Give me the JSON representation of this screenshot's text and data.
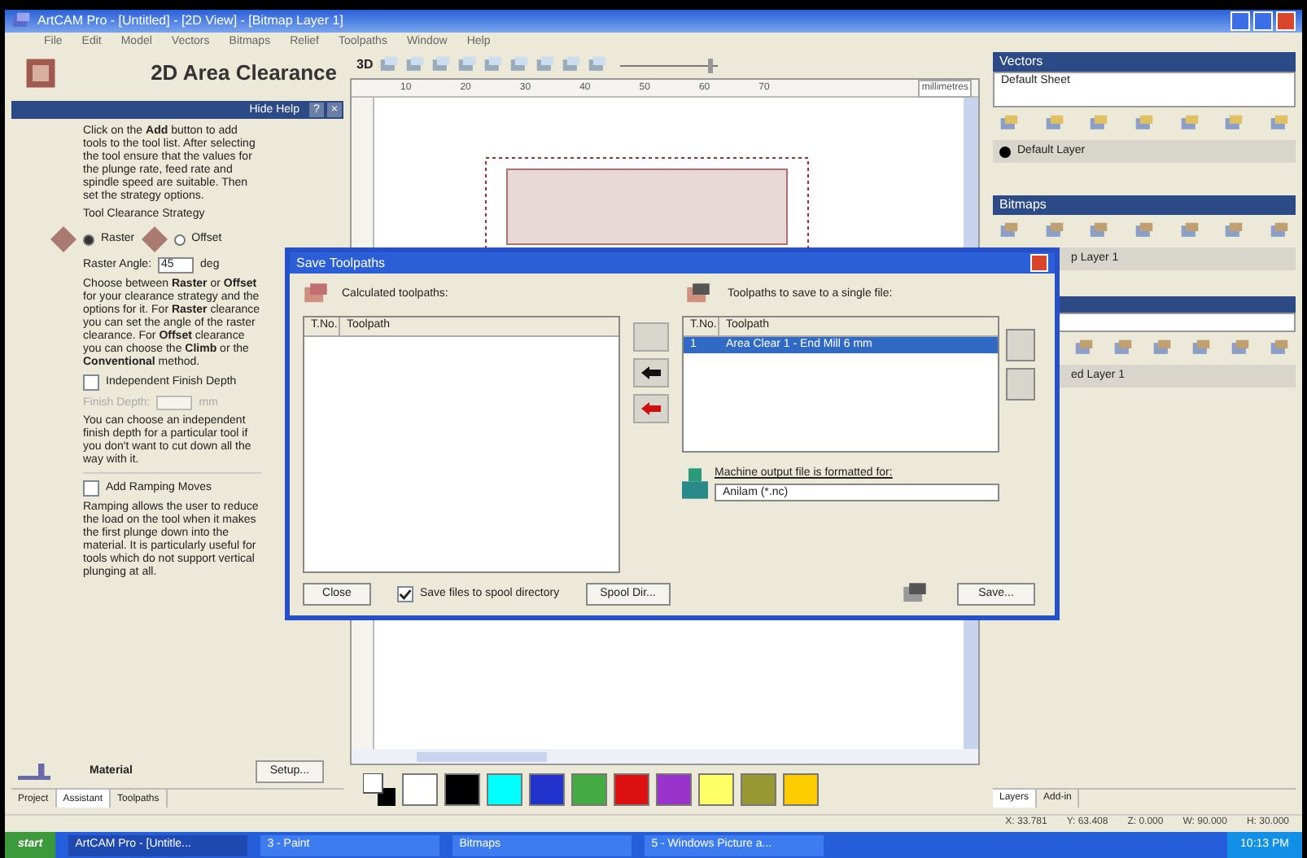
{
  "window": {
    "title": "ArtCAM Pro - [Untitled] - [2D View] - [Bitmap Layer 1]"
  },
  "menu": [
    "File",
    "Edit",
    "Model",
    "Vectors",
    "Bitmaps",
    "Relief",
    "Toolpaths",
    "Window",
    "Help"
  ],
  "left_panel": {
    "title": "2D Area Clearance",
    "help_bar": "Hide Help",
    "help_button": "?",
    "close_button": "×",
    "intro": "Click on the **Add** button to add tools to the tool list. After selecting the tool ensure that the values for the plunge rate, feed rate and spindle speed are suitable. Then set the strategy options.",
    "strategy_label": "Tool Clearance Strategy",
    "strategies": [
      {
        "label": "Raster",
        "selected": true
      },
      {
        "label": "Offset",
        "selected": false
      }
    ],
    "angle_label": "Raster Angle:",
    "angle_value": "45",
    "angle_unit": "deg",
    "strategy_help": "Choose between **Raster** or **Offset** for your clearance strategy and the options for it. For **Raster** clearance you can set the angle of the raster clearance. For **Offset** clearance you can choose the **Climb** or the **Conventional** method.",
    "finish": {
      "label": "Independent Finish Depth",
      "checked": false,
      "field_label": "Finish Depth:",
      "unit": "mm"
    },
    "finish_help": "You can choose an independent finish depth for a particular tool if you don't want to cut down all the way with it.",
    "ramping": {
      "label": "Add Ramping Moves",
      "checked": false
    },
    "ramping_help": "Ramping allows the user to reduce the load on the tool when it makes the first plunge down into the material. It is particularly useful for tools which do not support vertical plunging at all.",
    "material_label": "Material",
    "setup_button": "Setup...",
    "tabs": [
      {
        "label": "Project",
        "selected": false
      },
      {
        "label": "Assistant",
        "selected": true
      },
      {
        "label": "Toolpaths",
        "selected": false
      }
    ]
  },
  "canvas": {
    "toolbar_label": "3D",
    "zoom": {
      "level": 0.95
    },
    "ruler": [
      "10",
      "20",
      "30",
      "40",
      "50",
      "60",
      "70"
    ],
    "ruler_unit": "millimetres",
    "palette": [
      {
        "color": "#ffffff"
      },
      {
        "color": "#000000"
      },
      {
        "color": "#00ffff"
      },
      {
        "color": "#2233cc"
      },
      {
        "color": "#44aa44"
      },
      {
        "color": "#dd1111"
      },
      {
        "color": "#9933cc"
      },
      {
        "color": "#ffff66"
      },
      {
        "color": "#999933"
      },
      {
        "color": "#ffcc00"
      }
    ]
  },
  "right_panel": {
    "vectors": {
      "title": "Vectors",
      "sheet": "Default Sheet",
      "layer": "Default Layer"
    },
    "bitmaps": {
      "title": "Bitmaps",
      "layer": "p Layer 1"
    },
    "reliefs": {
      "layer": "ed Layer 1"
    },
    "tabs": [
      {
        "label": "Layers",
        "selected": true
      },
      {
        "label": "Add-in",
        "selected": false
      }
    ]
  },
  "dialog": {
    "title": "Save Toolpaths",
    "left_label": "Calculated toolpaths:",
    "right_label": "Toolpaths to save to a single file:",
    "left_columns": [
      "T.No.",
      "Toolpath"
    ],
    "right_columns": [
      "T.No.",
      "Toolpath"
    ],
    "rows": [
      {
        "number": "1",
        "name": "Area Clear 1 - End Mill 6 mm",
        "selected": true
      }
    ],
    "format_label": "Machine output file is formatted for:",
    "format_value": "Anilam (*.nc)",
    "close_button": "Close",
    "spool": {
      "label": "Save files to spool directory",
      "checked": true
    },
    "spool_button": "Spool Dir...",
    "save_button": "Save..."
  },
  "status_bar": [
    "X: 33.781",
    "Y: 63.408",
    "Z: 0.000",
    "W: 90.000",
    "H: 30.000"
  ],
  "taskbar": {
    "start": "start",
    "items": [
      {
        "label": "ArtCAM Pro - [Untitle...",
        "selected": true
      },
      {
        "label": "3 - Paint",
        "selected": false
      },
      {
        "label": "Bitmaps",
        "selected": false
      },
      {
        "label": "5 - Windows Picture a...",
        "selected": false
      }
    ],
    "time": "10:13 PM"
  }
}
